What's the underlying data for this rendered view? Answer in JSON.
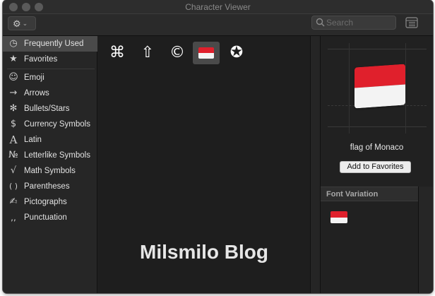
{
  "window": {
    "title": "Character Viewer"
  },
  "toolbar": {
    "gear_icon": "gear-icon",
    "search_placeholder": "Search",
    "grid_icon": "character-grid-icon"
  },
  "sidebar": {
    "items": [
      {
        "label": "Frequently Used",
        "icon": "◷",
        "icon_name": "clock-icon",
        "selected": true
      },
      {
        "label": "Favorites",
        "icon": "★",
        "icon_name": "star-icon"
      },
      {
        "label": "Emoji",
        "icon": "☺",
        "icon_name": "smiley-icon"
      },
      {
        "label": "Arrows",
        "icon": "→",
        "icon_name": "arrow-icon"
      },
      {
        "label": "Bullets/Stars",
        "icon": "✻",
        "icon_name": "asterisk-icon"
      },
      {
        "label": "Currency Symbols",
        "icon": "$",
        "icon_name": "dollar-icon"
      },
      {
        "label": "Latin",
        "icon": "A",
        "icon_name": "latin-icon"
      },
      {
        "label": "Letterlike Symbols",
        "icon": "№",
        "icon_name": "numero-icon"
      },
      {
        "label": "Math Symbols",
        "icon": "√",
        "icon_name": "square-root-icon"
      },
      {
        "label": "Parentheses",
        "icon": "( )",
        "icon_name": "parentheses-icon"
      },
      {
        "label": "Pictographs",
        "icon": "✍",
        "icon_name": "pictograph-icon"
      },
      {
        "label": "Punctuation",
        "icon": ",,",
        "icon_name": "punctuation-icon"
      }
    ]
  },
  "glyphs": [
    {
      "char": "⌘",
      "name": "command-key-glyph"
    },
    {
      "char": "⇧",
      "name": "shift-arrow-glyph"
    },
    {
      "char": "©",
      "name": "copyright-glyph"
    },
    {
      "char": "flag",
      "name": "monaco-flag-glyph",
      "selected": true
    },
    {
      "char": "✪",
      "name": "star-circle-glyph"
    }
  ],
  "watermark": "Milsmilo Blog",
  "detail": {
    "character_name": "flag of Monaco",
    "add_favorites_label": "Add to Favorites",
    "font_variation_header": "Font Variation"
  },
  "colors": {
    "flag_red": "#e0202c",
    "flag_white": "#f4f4f4"
  }
}
